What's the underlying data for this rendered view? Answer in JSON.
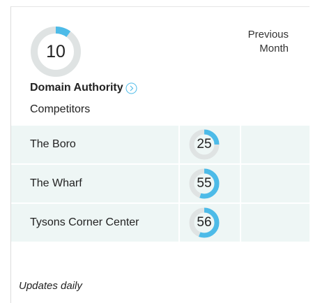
{
  "metric": {
    "value": "10",
    "score": 10,
    "title": "Domain Authority",
    "previous_label_line1": "Previous",
    "previous_label_line2": "Month",
    "section_label": "Competitors"
  },
  "competitors": [
    {
      "name": "The Boro",
      "value": "25",
      "score": 25
    },
    {
      "name": "The Wharf",
      "value": "55",
      "score": 55
    },
    {
      "name": "Tysons Corner Center",
      "value": "56",
      "score": 56
    }
  ],
  "footer": {
    "note": "Updates daily"
  },
  "colors": {
    "accent": "#4dbbe8",
    "track": "#dfe3e3",
    "row_bg": "#eef6f5"
  },
  "icons": {
    "info": "chevron-right-circle-icon"
  }
}
